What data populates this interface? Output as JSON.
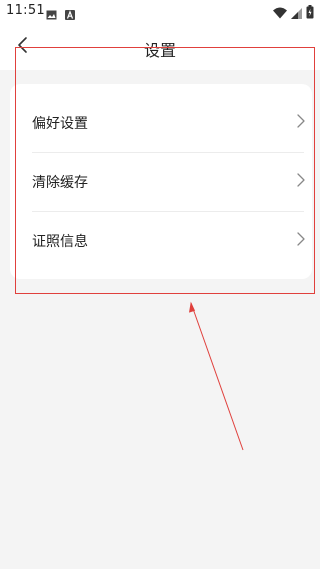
{
  "status_bar": {
    "time": "11:51",
    "left_icons": [
      "image-icon",
      "a-badge-icon"
    ],
    "right_icons": [
      "wifi-icon",
      "signal-icon",
      "battery-icon"
    ]
  },
  "header": {
    "title": "设置",
    "back_icon": "chevron-left-icon"
  },
  "settings": {
    "items": [
      {
        "label": "偏好设置",
        "icon": "chevron-right-icon"
      },
      {
        "label": "清除缓存",
        "icon": "chevron-right-icon"
      },
      {
        "label": "证照信息",
        "icon": "chevron-right-icon"
      }
    ]
  },
  "annotation": {
    "box_color": "#e0403c"
  }
}
